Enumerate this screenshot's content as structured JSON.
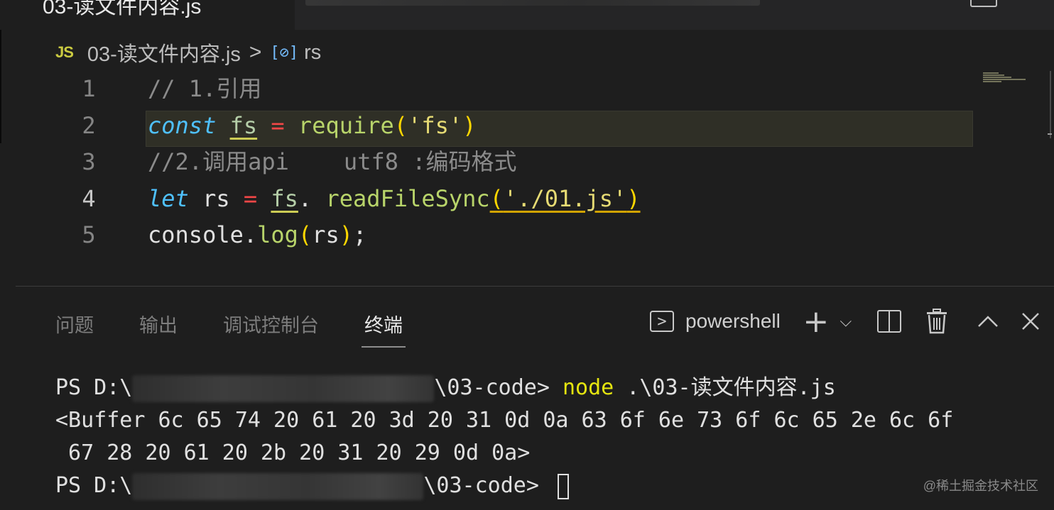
{
  "editor": {
    "breadcrumb": {
      "file_badge": "JS",
      "file_name": "03-读文件内容.js",
      "separator": ">",
      "symbol_icon": "[⊘]",
      "symbol_name": "rs"
    },
    "lines": [
      {
        "number": "1",
        "tokens": [
          {
            "t": "// 1.引用",
            "c": "c-comment-gray"
          }
        ]
      },
      {
        "number": "2",
        "tokens": [
          {
            "t": "const",
            "c": "c-kw"
          },
          {
            "t": " ",
            "c": "c-plain"
          },
          {
            "t": "fs",
            "c": "c-fs u-yellow"
          },
          {
            "t": " ",
            "c": "c-plain"
          },
          {
            "t": "=",
            "c": "c-op"
          },
          {
            "t": " ",
            "c": "c-plain"
          },
          {
            "t": "require",
            "c": "c-fn"
          },
          {
            "t": "(",
            "c": "c-paren"
          },
          {
            "t": "'fs'",
            "c": "c-str2"
          },
          {
            "t": ")",
            "c": "c-paren"
          }
        ]
      },
      {
        "number": "3",
        "tokens": [
          {
            "t": "//2.调用api    utf8 :编码格式",
            "c": "c-comment-gray"
          }
        ]
      },
      {
        "number": "4",
        "tokens": [
          {
            "t": "let",
            "c": "c-kw"
          },
          {
            "t": " rs ",
            "c": "c-plain"
          },
          {
            "t": "=",
            "c": "c-op"
          },
          {
            "t": " ",
            "c": "c-plain"
          },
          {
            "t": "fs",
            "c": "c-fs u-yellow"
          },
          {
            "t": ". ",
            "c": "c-plain"
          },
          {
            "t": "readFileSync",
            "c": "c-fn"
          },
          {
            "t": "(",
            "c": "c-paren u-gold"
          },
          {
            "t": "'./01.js'",
            "c": "c-str2 u-gold"
          },
          {
            "t": ")",
            "c": "c-paren u-gold"
          }
        ]
      },
      {
        "number": "5",
        "tokens": [
          {
            "t": "console",
            "c": "c-plain"
          },
          {
            "t": ".",
            "c": "c-plain"
          },
          {
            "t": "log",
            "c": "c-fn"
          },
          {
            "t": "(",
            "c": "c-paren"
          },
          {
            "t": "rs",
            "c": "c-plain"
          },
          {
            "t": ")",
            "c": "c-paren"
          },
          {
            "t": ";",
            "c": "c-plain"
          }
        ]
      }
    ],
    "current_line": 4
  },
  "panel": {
    "tabs": [
      {
        "label": "问题",
        "active": false
      },
      {
        "label": "输出",
        "active": false
      },
      {
        "label": "调试控制台",
        "active": false
      },
      {
        "label": "终端",
        "active": true
      }
    ],
    "shell_icon": ">",
    "shell_label": "powershell",
    "actions": {
      "new_terminal": "+",
      "dropdown": "⌵",
      "maximize": "^",
      "close": "✕"
    }
  },
  "terminal": {
    "line1": {
      "prompt_prefix": "PS D:\\",
      "prompt_suffix": "\\03-code> ",
      "command": "node",
      "args": " .\\03-读文件内容.js"
    },
    "line2": "<Buffer 6c 65 74 20 61 20 3d 20 31 0d 0a 63 6f 6e 73 6f 6c 65 2e 6c 6f",
    "line3": " 67 28 20 61 20 2b 20 31 20 29 0d 0a>",
    "line4": {
      "prompt_prefix": "PS D:\\",
      "prompt_suffix": "\\03-code> "
    }
  },
  "tab": {
    "title": "03-读文件内容.js"
  },
  "watermark": "@稀土掘金技术社区"
}
